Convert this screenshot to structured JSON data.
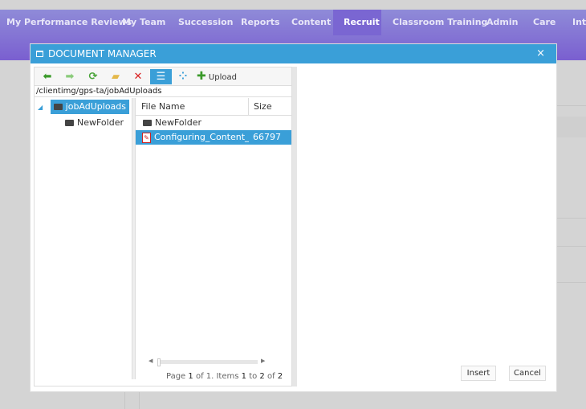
{
  "nav": {
    "items": [
      {
        "label": "My Performance Reviews",
        "active": false
      },
      {
        "label": "My Team",
        "active": false
      },
      {
        "label": "Succession",
        "active": false
      },
      {
        "label": "Reports",
        "active": false
      },
      {
        "label": "Content",
        "active": false
      },
      {
        "label": "Recruit",
        "active": true
      },
      {
        "label": "Classroom Training",
        "active": false
      },
      {
        "label": "Admin",
        "active": false
      },
      {
        "label": "Care",
        "active": false
      },
      {
        "label": "Inte",
        "active": false
      }
    ]
  },
  "dialog": {
    "title": "DOCUMENT MANAGER",
    "close": "×",
    "toolbar": {
      "upload_label": "Upload",
      "icons": [
        "back-icon",
        "forward-icon",
        "refresh-icon",
        "new-folder-icon",
        "delete-icon",
        "list-view-icon",
        "thumbnail-view-icon",
        "upload-icon"
      ]
    },
    "path": "/clientimg/gps-ta/jobAdUploads",
    "tree": {
      "root": "jobAdUploads",
      "children": [
        "NewFolder"
      ]
    },
    "grid": {
      "columns": [
        "File Name",
        "Size"
      ],
      "rows": [
        {
          "name": "NewFolder",
          "size": "",
          "type": "folder",
          "selected": false
        },
        {
          "name": "Configuring_Content_Vendors",
          "size": "66797",
          "type": "pdf",
          "selected": true
        }
      ]
    },
    "pager": {
      "p1": "Page ",
      "page": "1",
      "p2": " of 1. Items ",
      "from": "1",
      "p3": " to ",
      "to": "2",
      "p4": " of ",
      "total": "2"
    },
    "insert_label": "Insert",
    "cancel_label": "Cancel"
  },
  "colors": {
    "accent": "#3a9fd8",
    "nav": "#8a7ed6"
  }
}
